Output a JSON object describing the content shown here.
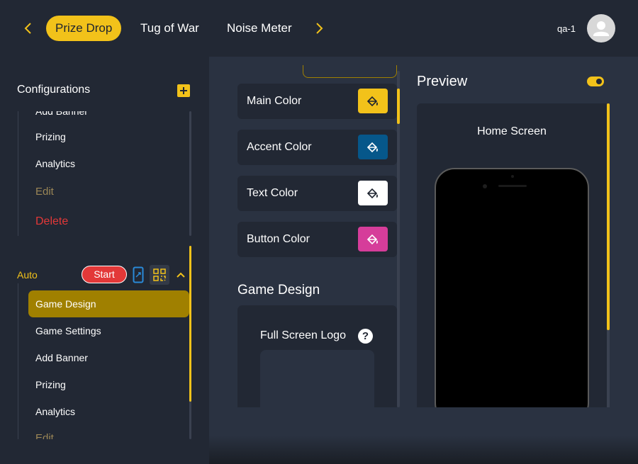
{
  "header": {
    "tabs": [
      "Prize Drop",
      "Tug of War",
      "Noise Meter"
    ],
    "username": "qa-1"
  },
  "sidebar": {
    "configurations_title": "Configurations",
    "first_game_items": [
      "Add Banner",
      "Prizing",
      "Analytics",
      "Edit",
      "Delete"
    ],
    "auto_label": "Auto",
    "start_label": "Start",
    "auto_items": [
      "Game Design",
      "Game Settings",
      "Add Banner",
      "Prizing",
      "Analytics",
      "Edit"
    ]
  },
  "design": {
    "colors": [
      {
        "label": "Main Color",
        "swatch": "#f2c21a"
      },
      {
        "label": "Accent Color",
        "swatch": "#06578a"
      },
      {
        "label": "Text Color",
        "swatch": "#ffffff"
      },
      {
        "label": "Button Color",
        "swatch": "#d63d9a"
      }
    ],
    "game_design_title": "Game Design",
    "full_screen_logo_label": "Full Screen Logo",
    "help_glyph": "?"
  },
  "preview": {
    "title": "Preview",
    "screen_label": "Home Screen"
  },
  "theme": {
    "accent": "#f2c21a",
    "background": "#222834",
    "panel": "#2a3241",
    "danger": "#e33838",
    "selected": "#a08000"
  }
}
